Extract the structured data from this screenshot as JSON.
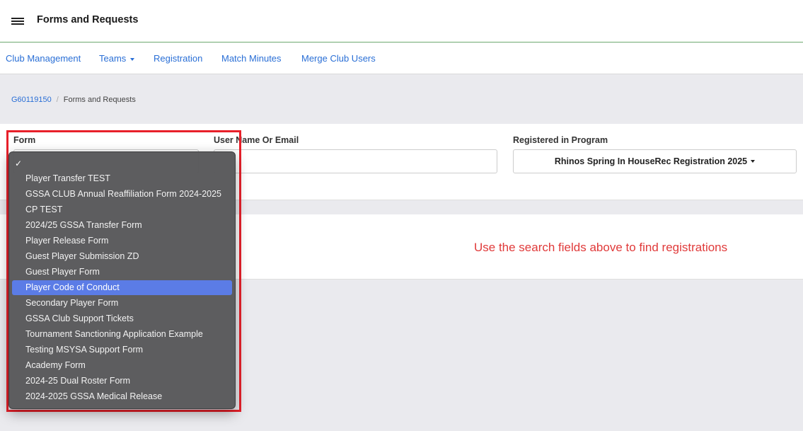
{
  "header": {
    "title": "Forms and Requests"
  },
  "nav": {
    "items": [
      "Club Management",
      "Teams",
      "Registration",
      "Match Minutes",
      "Merge Club Users"
    ]
  },
  "breadcrumb": {
    "root": "G60119150",
    "current": "Forms and Requests"
  },
  "filters": {
    "form_label": "Form",
    "user_label": "User Name Or Email",
    "user_value": "",
    "program_label": "Registered in Program",
    "program_value": "Rhinos Spring In HouseRec Registration 2025"
  },
  "results": {
    "empty_message": "Use the search fields above to find registrations"
  },
  "form_dropdown": {
    "check_glyph": "✓",
    "options": [
      "Player Transfer TEST",
      "GSSA CLUB Annual Reaffiliation Form 2024-2025",
      "CP TEST",
      "2024/25 GSSA Transfer Form",
      "Player Release Form",
      "Guest Player Submission ZD",
      "Guest Player Form",
      "Player Code of Conduct",
      "Secondary Player Form",
      "GSSA Club Support Tickets",
      "Tournament Sanctioning Application Example",
      "Testing MSYSA Support Form",
      "Academy Form",
      "2024-25 Dual Roster Form",
      "2024-2025 GSSA Medical Release"
    ],
    "highlighted_option": "Player Code of Conduct"
  },
  "colors": {
    "link": "#2a6fd6",
    "accent_line": "#7cb87a",
    "highlight_border": "#e8202a",
    "selected_option": "#5b7ce6",
    "empty_message": "#e03a3a"
  }
}
